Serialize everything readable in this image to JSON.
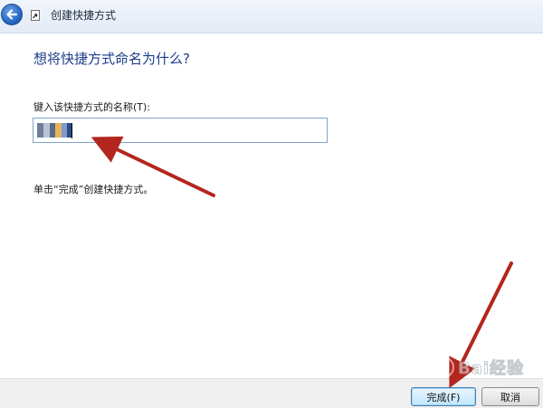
{
  "window": {
    "title": "创建快捷方式"
  },
  "content": {
    "heading": "想将快捷方式命名为什么?",
    "name_label": "键入该快捷方式的名称(T):",
    "name_value": "",
    "instruction": "单击“完成”创建快捷方式。"
  },
  "buttons": {
    "finish_label": "完成(F)",
    "cancel_label": "取消"
  },
  "icons": {
    "back": "back-arrow-icon",
    "title": "shortcut-icon"
  },
  "colors": {
    "heading": "#1a3c8a",
    "annotation_arrow": "#b3261e",
    "input_border": "#7ea4cc",
    "default_button_border": "#3c7fb1"
  }
}
